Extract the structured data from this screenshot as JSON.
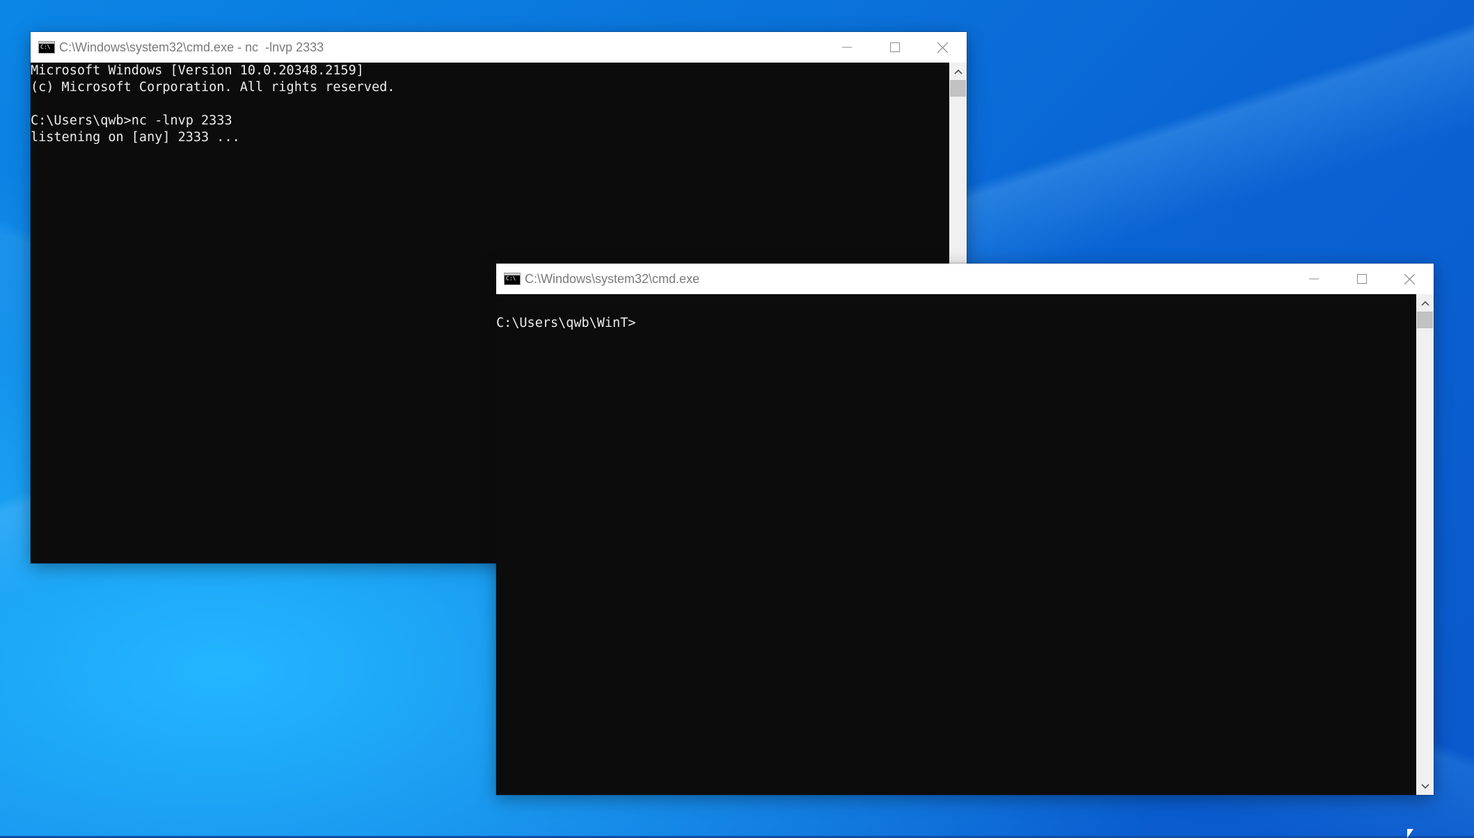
{
  "windows": [
    {
      "title": "C:\\Windows\\system32\\cmd.exe - nc  -lnvp 2333",
      "lines": [
        "Microsoft Windows [Version 10.0.20348.2159]",
        "(c) Microsoft Corporation. All rights reserved.",
        "",
        "C:\\Users\\qwb>nc -lnvp 2333",
        "listening on [any] 2333 ..."
      ],
      "icon": "cmd-icon"
    },
    {
      "title": "C:\\Windows\\system32\\cmd.exe",
      "lines": [
        "",
        "C:\\Users\\qwb\\WinT>"
      ],
      "icon": "cmd-icon"
    }
  ],
  "controls": {
    "minimize": "minimize-icon",
    "maximize": "maximize-icon",
    "close": "close-icon"
  }
}
